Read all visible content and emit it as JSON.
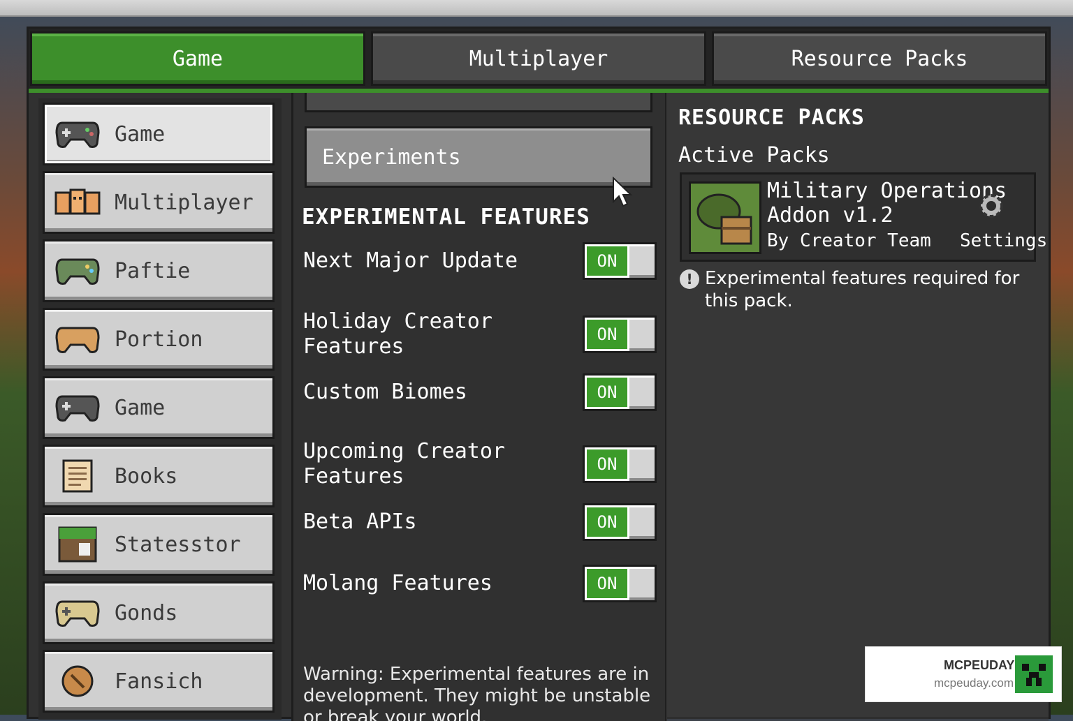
{
  "tabs": {
    "game": "Game",
    "multiplayer": "Multiplayer",
    "resource_packs": "Resource Packs"
  },
  "sidebar": {
    "items": [
      {
        "label": "Game",
        "icon": "controller-icon"
      },
      {
        "label": "Multiplayer",
        "icon": "players-icon"
      },
      {
        "label": "Paftie",
        "icon": "controller-icon"
      },
      {
        "label": "Portion",
        "icon": "controller-icon"
      },
      {
        "label": "Game",
        "icon": "controller-icon"
      },
      {
        "label": "Books",
        "icon": "book-icon"
      },
      {
        "label": "Statesstor",
        "icon": "grass-block-icon"
      },
      {
        "label": "Gonds",
        "icon": "controller-icon"
      },
      {
        "label": "Fansich",
        "icon": "compass-icon"
      }
    ]
  },
  "middle": {
    "experiments_button": "Experiments",
    "section_title": "EXPERIMENTAL FEATURES",
    "toggle_on_label": "ON",
    "features": [
      {
        "label": "Next Major Update",
        "state": "ON"
      },
      {
        "label": "Holiday Creator Features",
        "state": "ON"
      },
      {
        "label": "Custom Biomes",
        "state": "ON"
      },
      {
        "label": "Upcoming Creator Features",
        "state": "ON"
      },
      {
        "label": "Beta APIs",
        "state": "ON"
      },
      {
        "label": "Molang Features",
        "state": "ON"
      }
    ],
    "warning": "Warning: Experimental features are in development. They might be unstable or break your world."
  },
  "resource_packs": {
    "title": "RESOURCE PACKS",
    "active_label": "Active Packs",
    "pack": {
      "name": "Military Operations Addon v1.2",
      "author": "By Creator Team",
      "settings_label": "Settings"
    },
    "note": "Experimental features required for this pack."
  },
  "watermark": {
    "brand": "MCPEUDAY",
    "url": "mcpeuday.com"
  },
  "colors": {
    "accent_green": "#3d8f2b",
    "toggle_green": "#3c9b2a",
    "panel_dark": "#303030"
  }
}
